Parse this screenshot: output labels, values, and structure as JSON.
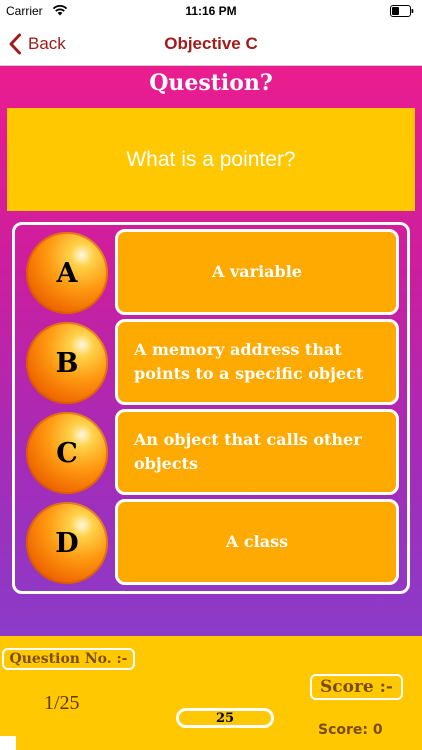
{
  "status_bar": {
    "carrier": "Carrier",
    "time": "11:16 PM"
  },
  "nav": {
    "back_label": "Back",
    "title": "Objective C"
  },
  "question": {
    "heading": "Question?",
    "text": "What is a pointer?"
  },
  "options": [
    {
      "letter": "A",
      "text": "A variable"
    },
    {
      "letter": "B",
      "text": "A memory address that points to a specific object"
    },
    {
      "letter": "C",
      "text": "An object that calls other objects"
    },
    {
      "letter": "D",
      "text": "A class"
    }
  ],
  "footer": {
    "question_no_label": "Question No. :-",
    "question_no_value": "1/25",
    "progress_value": "25",
    "score_label": "Score :-",
    "score_value": "Score: 0"
  },
  "colors": {
    "accent": "#a01c1c",
    "gradient_top": "#ea1d8f",
    "gradient_bottom": "#8a3cc9",
    "question_box": "#ffc800",
    "option_box": "#ffaa00",
    "footer_bg": "#ffc800"
  },
  "icons": {
    "back": "chevron-left-icon",
    "wifi": "wifi-icon",
    "battery": "battery-icon"
  }
}
